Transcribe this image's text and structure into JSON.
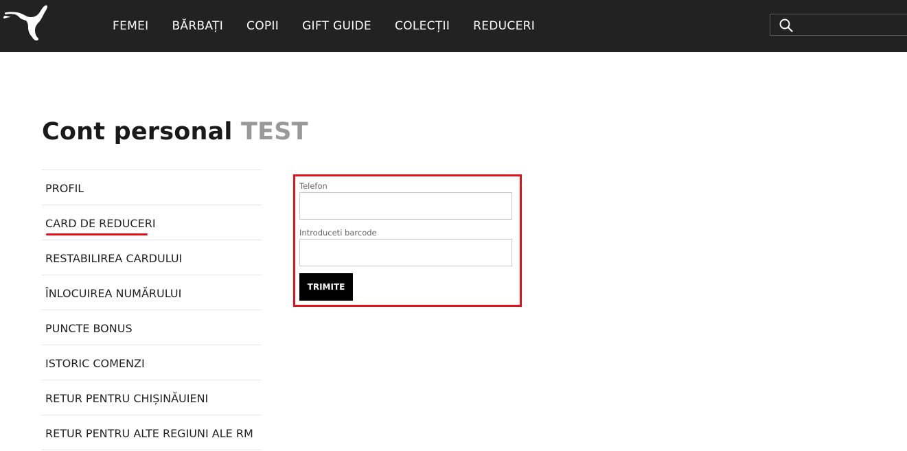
{
  "header": {
    "logo": "puma-logo",
    "nav": [
      {
        "label": "FEMEI"
      },
      {
        "label": "BĂRBAȚI"
      },
      {
        "label": "COPII"
      },
      {
        "label": "GIFT GUIDE"
      },
      {
        "label": "COLECȚII"
      },
      {
        "label": "REDUCERI"
      }
    ],
    "search": {
      "icon": "search-icon",
      "placeholder": ""
    }
  },
  "account": {
    "title": "Cont personal",
    "user_name": "TEST"
  },
  "sidebar": {
    "items": [
      {
        "label": "PROFIL",
        "active": false
      },
      {
        "label": "CARD DE REDUCERI",
        "active": true
      },
      {
        "label": "RESTABILIREA CARDULUI",
        "active": false
      },
      {
        "label": "ÎNLOCUIREA NUMĂRULUI",
        "active": false
      },
      {
        "label": "PUNCTE BONUS",
        "active": false
      },
      {
        "label": "ISTORIC COMENZI",
        "active": false
      },
      {
        "label": "RETUR PENTRU CHIȘINĂUIENI",
        "active": false
      },
      {
        "label": "RETUR PENTRU ALTE REGIUNI ALE RM",
        "active": false
      }
    ]
  },
  "form": {
    "phone_label": "Telefon",
    "phone_value": "",
    "barcode_label": "Introduceti barcode",
    "barcode_value": "",
    "submit_label": "TRIMITE"
  },
  "colors": {
    "header_bg": "#222222",
    "accent": "#e0121a",
    "button_bg": "#000000",
    "muted_text": "#999999"
  }
}
